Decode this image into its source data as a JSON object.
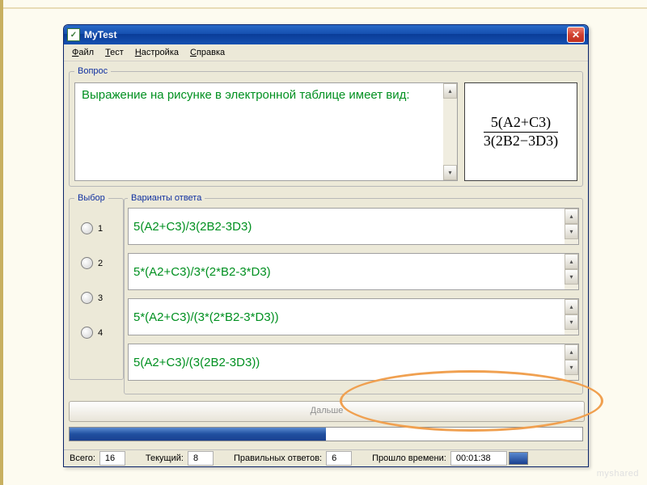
{
  "window": {
    "title": "MyTest",
    "close_glyph": "✕"
  },
  "menu": {
    "file": "айл",
    "file_u": "Ф",
    "test": "ест",
    "test_u": "Т",
    "settings": "астройка",
    "settings_u": "Н",
    "help": "правка",
    "help_u": "С"
  },
  "question": {
    "legend": "Вопрос",
    "text": "Выражение на рисунке в электронной таблице имеет вид:",
    "formula_num": "5(A2+C3)",
    "formula_den": "3(2B2−3D3)"
  },
  "choice": {
    "legend": "Выбор",
    "labels": [
      "1",
      "2",
      "3",
      "4"
    ]
  },
  "answers": {
    "legend": "Варианты ответа",
    "items": [
      "5(A2+C3)/3(2B2-3D3)",
      "5*(A2+C3)/3*(2*B2-3*D3)",
      "5*(A2+C3)/(3*(2*B2-3*D3))",
      "5(A2+C3)/(3(2B2-3D3))"
    ]
  },
  "buttons": {
    "next": "Дальше"
  },
  "progress": {
    "percent": 50
  },
  "status": {
    "total_label": "Всего:",
    "total_value": "16",
    "current_label": "Текущий:",
    "current_value": "8",
    "correct_label": "Правильных ответов:",
    "correct_value": "6",
    "elapsed_label": "Прошло времени:",
    "elapsed_value": "00:01:38"
  },
  "watermark": "myshared"
}
